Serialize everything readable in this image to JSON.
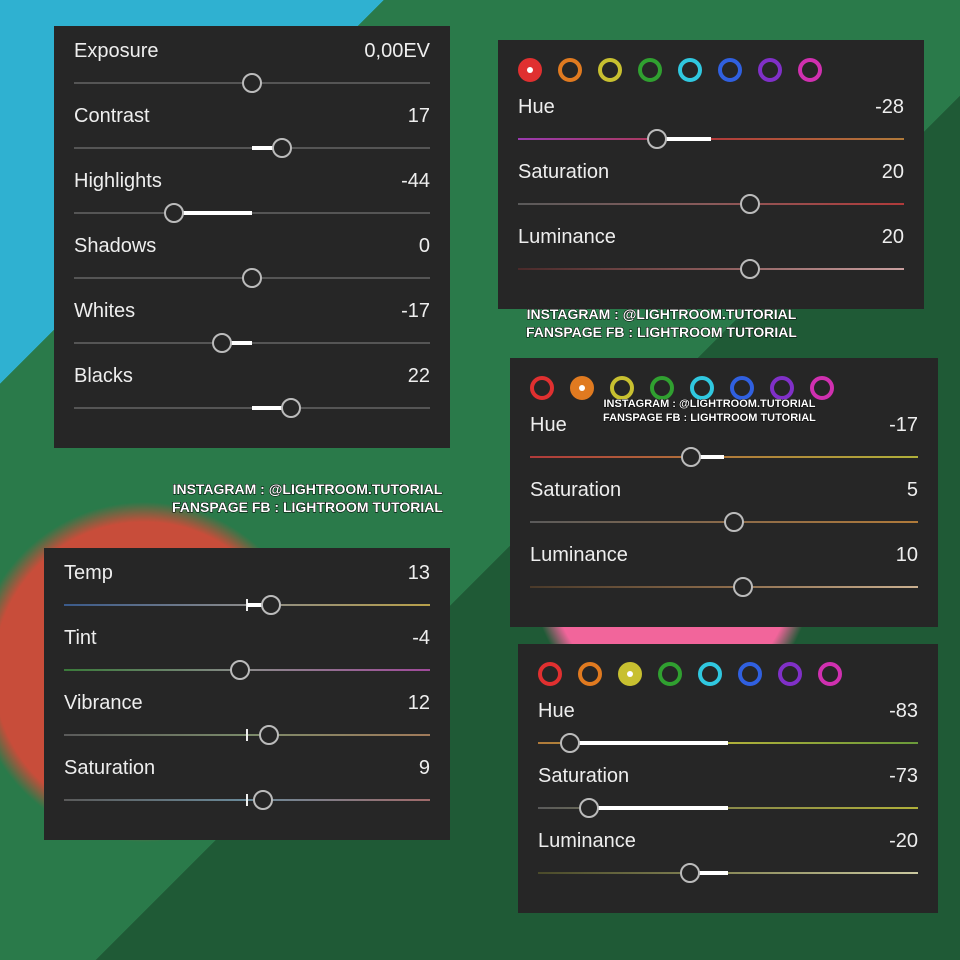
{
  "panelA": {
    "sliders": [
      {
        "label": "Exposure",
        "value": "0,00EV",
        "pos": 50,
        "fill": null
      },
      {
        "label": "Contrast",
        "value": "17",
        "pos": 58.5,
        "fill": [
          50,
          58.5
        ]
      },
      {
        "label": "Highlights",
        "value": "-44",
        "pos": 28,
        "fill": [
          28,
          50
        ]
      },
      {
        "label": "Shadows",
        "value": "0",
        "pos": 50,
        "fill": null
      },
      {
        "label": "Whites",
        "value": "-17",
        "pos": 41.5,
        "fill": [
          41.5,
          50
        ]
      },
      {
        "label": "Blacks",
        "value": "22",
        "pos": 61,
        "fill": [
          50,
          61
        ]
      }
    ]
  },
  "panelB": {
    "sliders": [
      {
        "label": "Temp",
        "value": "13",
        "pos": 56.5,
        "trackClass": "grad-temp",
        "tick": true,
        "fill": [
          50,
          56.5
        ]
      },
      {
        "label": "Tint",
        "value": "-4",
        "pos": 48,
        "trackClass": "grad-tint",
        "tick": true
      },
      {
        "label": "Vibrance",
        "value": "12",
        "pos": 56,
        "trackClass": "grad-vib",
        "tick": true
      },
      {
        "label": "Saturation",
        "value": "9",
        "pos": 54.5,
        "trackClass": "grad-sat",
        "tick": true
      }
    ]
  },
  "panelC": {
    "selected": 0,
    "sliders": [
      {
        "label": "Hue",
        "value": "-28",
        "pos": 36,
        "trackClass": "grad-hue-r",
        "fill": [
          36,
          50
        ]
      },
      {
        "label": "Saturation",
        "value": "20",
        "pos": 60,
        "trackClass": "grad-sat-r"
      },
      {
        "label": "Luminance",
        "value": "20",
        "pos": 60,
        "trackClass": "grad-lum-r"
      }
    ]
  },
  "panelD": {
    "selected": 1,
    "sliders": [
      {
        "label": "Hue",
        "value": "-17",
        "pos": 41.5,
        "trackClass": "grad-hue-o",
        "fill": [
          41.5,
          50
        ]
      },
      {
        "label": "Saturation",
        "value": "5",
        "pos": 52.5,
        "trackClass": "grad-sat-o"
      },
      {
        "label": "Luminance",
        "value": "10",
        "pos": 55,
        "trackClass": "grad-lum-o"
      }
    ]
  },
  "panelE": {
    "selected": 2,
    "sliders": [
      {
        "label": "Hue",
        "value": "-83",
        "pos": 8.5,
        "trackClass": "grad-hue-y",
        "fill": [
          8.5,
          50
        ]
      },
      {
        "label": "Saturation",
        "value": "-73",
        "pos": 13.5,
        "trackClass": "grad-sat-y",
        "fill": [
          13.5,
          50
        ]
      },
      {
        "label": "Luminance",
        "value": "-20",
        "pos": 40,
        "trackClass": "grad-lum-y",
        "fill": [
          40,
          50
        ]
      }
    ]
  },
  "swatchColors": [
    "#e03030",
    "#e07a20",
    "#c8c030",
    "#30a030",
    "#30c8e0",
    "#3060e0",
    "#8030c8",
    "#d030b0"
  ],
  "credit": {
    "line1": "INSTAGRAM : @LIGHTROOM.TUTORIAL",
    "line2": "FANSPAGE FB : LIGHTROOM TUTORIAL"
  }
}
